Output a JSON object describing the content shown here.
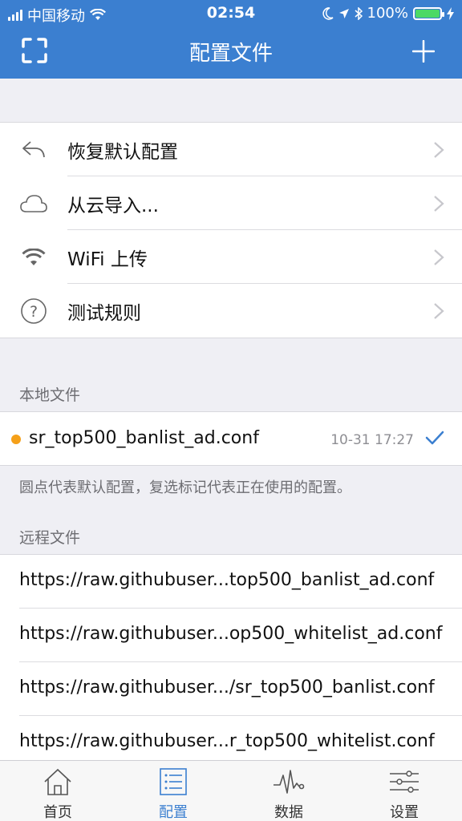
{
  "status_bar": {
    "carrier": "中国移动",
    "time": "02:54",
    "battery": "100%"
  },
  "header": {
    "title": "配置文件",
    "scan_icon": "scan-icon",
    "add_icon": "plus-icon"
  },
  "actions": [
    {
      "label": "恢复默认配置",
      "icon": "reply-icon"
    },
    {
      "label": "从云导入...",
      "icon": "cloud-icon"
    },
    {
      "label": "WiFi 上传",
      "icon": "wifi-icon"
    },
    {
      "label": "测试规则",
      "icon": "question-icon"
    }
  ],
  "local": {
    "header": "本地文件",
    "files": [
      {
        "name": "sr_top500_banlist_ad.conf",
        "time": "10-31 17:27",
        "is_default": true,
        "in_use": true
      }
    ],
    "footnote": "圆点代表默认配置，复选标记代表正在使用的配置。"
  },
  "remote": {
    "header": "远程文件",
    "files": [
      "https://raw.githubuser...top500_banlist_ad.conf",
      "https://raw.githubuser...op500_whitelist_ad.conf",
      "https://raw.githubuser.../sr_top500_banlist.conf",
      "https://raw.githubuser...r_top500_whitelist.conf"
    ]
  },
  "tabbar": {
    "tabs": [
      {
        "label": "首页",
        "icon": "home-icon"
      },
      {
        "label": "配置",
        "icon": "list-icon",
        "active": true
      },
      {
        "label": "数据",
        "icon": "activity-icon"
      },
      {
        "label": "设置",
        "icon": "sliders-icon"
      }
    ]
  },
  "colors": {
    "accent": "#3b7fd0",
    "default_dot": "#f5a019",
    "battery": "#4cd964"
  }
}
